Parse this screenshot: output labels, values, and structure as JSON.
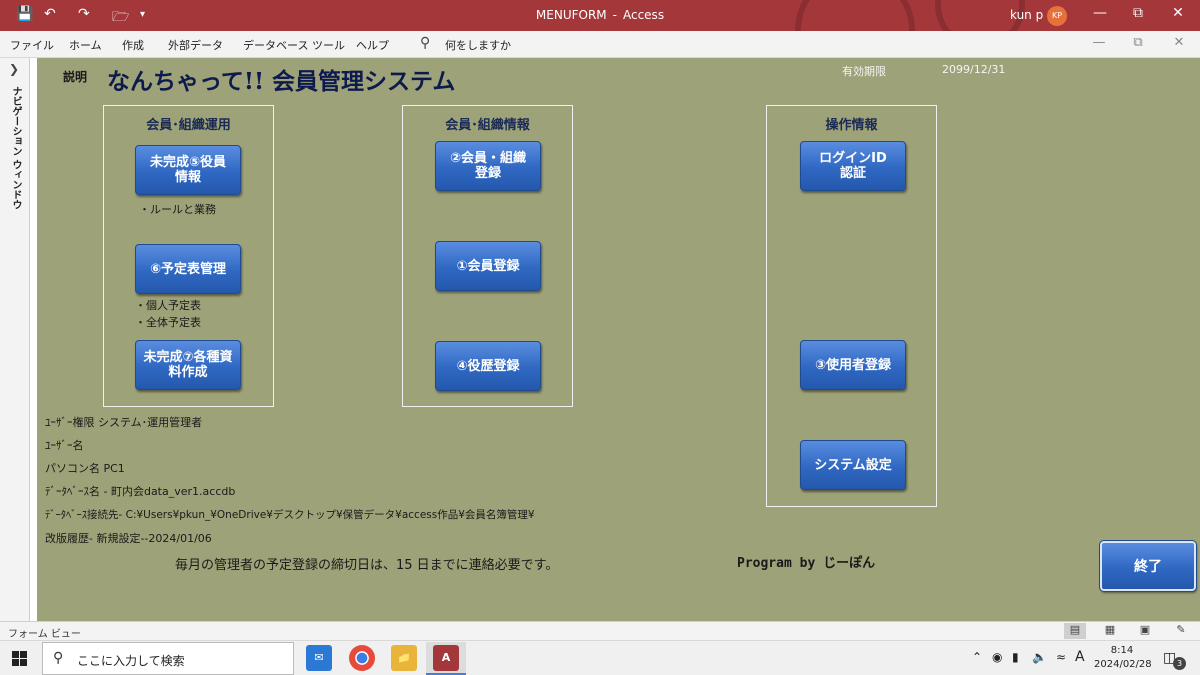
{
  "window": {
    "title": "MENUFORM",
    "separator": "-",
    "app_name": "Access",
    "user_name": "kun p",
    "user_initials": "KP"
  },
  "ribbon": {
    "tabs": [
      "ファイル",
      "ホーム",
      "作成",
      "外部データ",
      "データベース ツール",
      "ヘルプ"
    ],
    "search_placeholder": "何をしますか"
  },
  "nav_pane": {
    "label": "ナビゲーション ウィンドウ"
  },
  "form": {
    "desc_label": "説明",
    "app_title": "なんちゃって!! 会員管理システム",
    "expiry_label": "有効期限",
    "expiry_value": "2099/12/31",
    "groups": [
      {
        "title": "会員･組織運用",
        "buttons": [
          "未完成⑤役員\n情報",
          "⑥予定表管理",
          "未完成⑦各種資\n料作成"
        ],
        "notes": [
          "・ルールと業務",
          "・個人予定表",
          "・全体予定表"
        ]
      },
      {
        "title": "会員･組織情報",
        "buttons": [
          "②会員・組織\n登録",
          "①会員登録",
          "④役歴登録"
        ]
      },
      {
        "title": "操作情報",
        "buttons": [
          "ログインID\n認証",
          "③使用者登録",
          "システム設定"
        ]
      }
    ],
    "info": {
      "user_rights": "ﾕｰｻﾞｰ権限 システム･運用管理者",
      "user_name": "ﾕｰｻﾞｰ名",
      "pc_name": "パソコン名  PC1",
      "db_name": "ﾃﾞｰﾀﾍﾞｰｽ名 - 町内会data_ver1.accdb",
      "db_connection": "ﾃﾞｰﾀﾍﾞｰｽ接続先-  C:¥Users¥pkun_¥OneDrive¥デスクトップ¥保管データ¥access作品¥会員名簿管理¥",
      "revision": "改版履歴-  新規設定--2024/01/06"
    },
    "deadline_notice": "毎月の管理者の予定登録の締切日は、15  日までに連絡必要です。",
    "program_credit": "Program by じーぽん",
    "end_button": "終了"
  },
  "status_bar": {
    "view_label": "フォーム ビュー"
  },
  "taskbar": {
    "search_placeholder": "ここに入力して検索",
    "tray_ime": "A",
    "time": "8:14",
    "date": "2024/02/28",
    "notification_count": "3"
  }
}
